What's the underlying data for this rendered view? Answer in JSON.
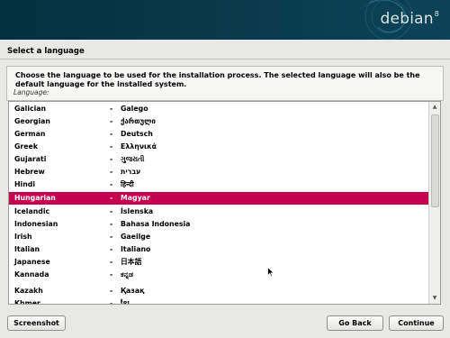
{
  "banner": {
    "brand": "debian",
    "version": "8"
  },
  "page": {
    "title": "Select a language",
    "instructions": "Choose the language to be used for the installation process. The selected language will also be the default language for the installed system.",
    "list_label": "Language:"
  },
  "languages": [
    {
      "name": "Galician",
      "dash": "-",
      "native": "Galego"
    },
    {
      "name": "Georgian",
      "dash": "-",
      "native": "ქართული"
    },
    {
      "name": "German",
      "dash": "-",
      "native": "Deutsch"
    },
    {
      "name": "Greek",
      "dash": "-",
      "native": "Ελληνικά"
    },
    {
      "name": "Gujarati",
      "dash": "-",
      "native": "ગુજરાતી"
    },
    {
      "name": "Hebrew",
      "dash": "-",
      "native": "עברית"
    },
    {
      "name": "Hindi",
      "dash": "-",
      "native": "हिन्दी"
    },
    {
      "name": "Hungarian",
      "dash": "-",
      "native": "Magyar"
    },
    {
      "name": "Icelandic",
      "dash": "-",
      "native": "Íslenska"
    },
    {
      "name": "Indonesian",
      "dash": "-",
      "native": "Bahasa Indonesia"
    },
    {
      "name": "Irish",
      "dash": "-",
      "native": "Gaeilge"
    },
    {
      "name": "Italian",
      "dash": "-",
      "native": "Italiano"
    },
    {
      "name": "Japanese",
      "dash": "-",
      "native": "日本語"
    },
    {
      "name": "Kannada",
      "dash": "-",
      "native": "ಕನ್ನಡ"
    },
    {
      "name": "Kazakh",
      "dash": "-",
      "native": "Қазақ"
    },
    {
      "name": "Khmer",
      "dash": "-",
      "native": "ខ្មែរ"
    }
  ],
  "selected_language": "Hungarian",
  "buttons": {
    "screenshot": "Screenshot",
    "go_back": "Go Back",
    "continue": "Continue"
  },
  "colors": {
    "selection": "#c6004f",
    "banner": "#03303f"
  },
  "icons": {
    "scroll_up": "triangle-up-icon",
    "scroll_down": "triangle-down-icon",
    "pointer": "mouse-pointer-icon",
    "banner_swirl": "debian-swirl-icon"
  }
}
